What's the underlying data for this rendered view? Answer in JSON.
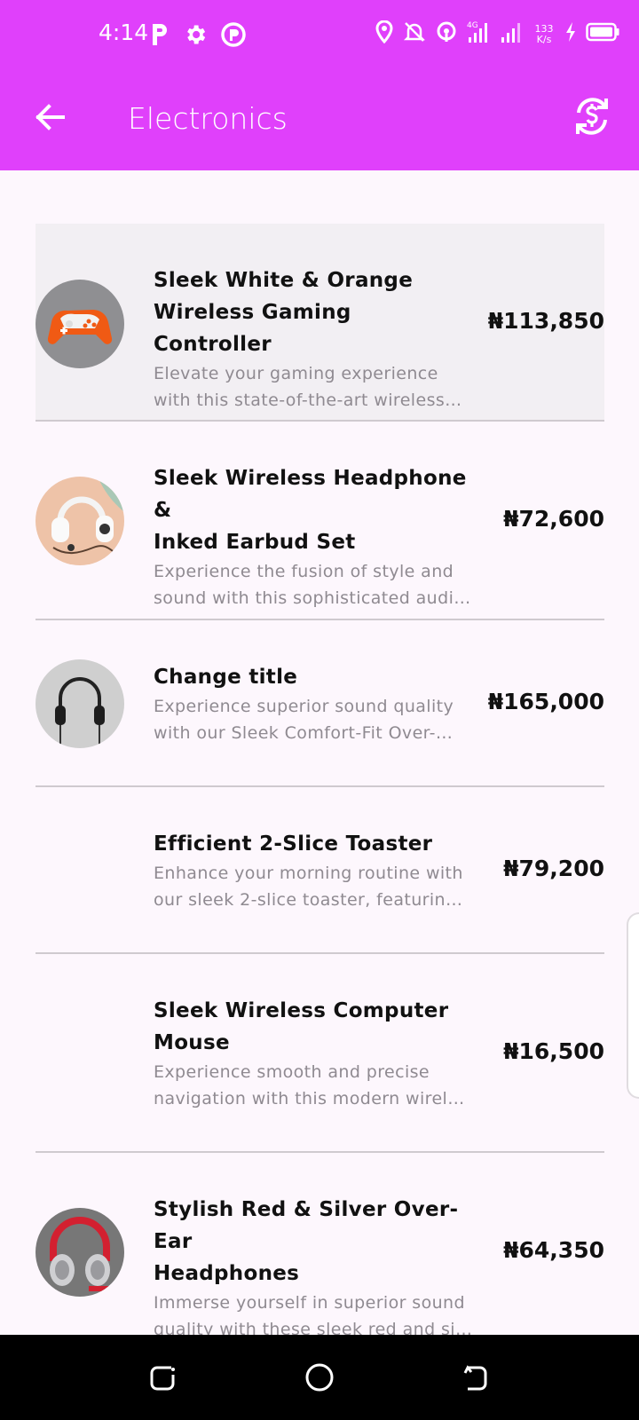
{
  "status": {
    "time": "4:14",
    "net_speed_value": "133",
    "net_speed_unit": "K/s",
    "left_icons": [
      "parking-icon",
      "settings-icon",
      "sync-icon"
    ],
    "right_icons": [
      "location-icon",
      "bell-off-icon",
      "hotspot-icon",
      "signal-4g-icon",
      "signal-icon",
      "charging-icon",
      "battery-icon"
    ]
  },
  "app_bar": {
    "title": "Electronics",
    "back_icon": "arrow-left-icon",
    "action_icon": "currency-exchange-icon"
  },
  "colors": {
    "accent": "#e040fb",
    "background": "#fdf7fd",
    "selected_row": "#f2eff3",
    "divider": "#cfcacf",
    "title_text": "#111111",
    "desc_text": "#8f8a91"
  },
  "products": [
    {
      "title_lines": [
        "Sleek White & Orange",
        "Wireless Gaming Controller"
      ],
      "description_lines": [
        "Elevate your gaming experience",
        "with this state-of-the-art wireless…"
      ],
      "price": "₦113,850",
      "has_image": true,
      "image": "game-controller-image",
      "selected": true
    },
    {
      "title_lines": [
        "Sleek Wireless Headphone &",
        "Inked Earbud Set"
      ],
      "description_lines": [
        "Experience the fusion of style and",
        "sound with this sophisticated audi…"
      ],
      "price": "₦72,600",
      "has_image": true,
      "image": "headphones-earbuds-image",
      "selected": false
    },
    {
      "title_lines": [
        "Change title"
      ],
      "description_lines": [
        "Experience superior sound quality",
        "with our Sleek Comfort-Fit Over-…"
      ],
      "price": "₦165,000",
      "has_image": true,
      "image": "black-headphones-image",
      "selected": false
    },
    {
      "title_lines": [
        "Efficient 2-Slice Toaster"
      ],
      "description_lines": [
        "Enhance your morning routine with",
        "our sleek 2-slice toaster, featuring …"
      ],
      "price": "₦79,200",
      "has_image": false,
      "selected": false
    },
    {
      "title_lines": [
        "Sleek Wireless Computer",
        "Mouse"
      ],
      "description_lines": [
        "Experience smooth and precise",
        "navigation with this modern wirele…"
      ],
      "price": "₦16,500",
      "has_image": false,
      "selected": false
    },
    {
      "title_lines": [
        "Stylish Red & Silver Over-Ear",
        "Headphones"
      ],
      "description_lines": [
        "Immerse yourself in superior sound",
        "quality with these sleek red and sil…"
      ],
      "price": "₦64,350",
      "has_image": true,
      "image": "red-headphones-image",
      "selected": false
    }
  ],
  "nav": {
    "recents_icon": "recents-icon",
    "home_icon": "home-icon",
    "back_icon": "back-gesture-icon"
  }
}
